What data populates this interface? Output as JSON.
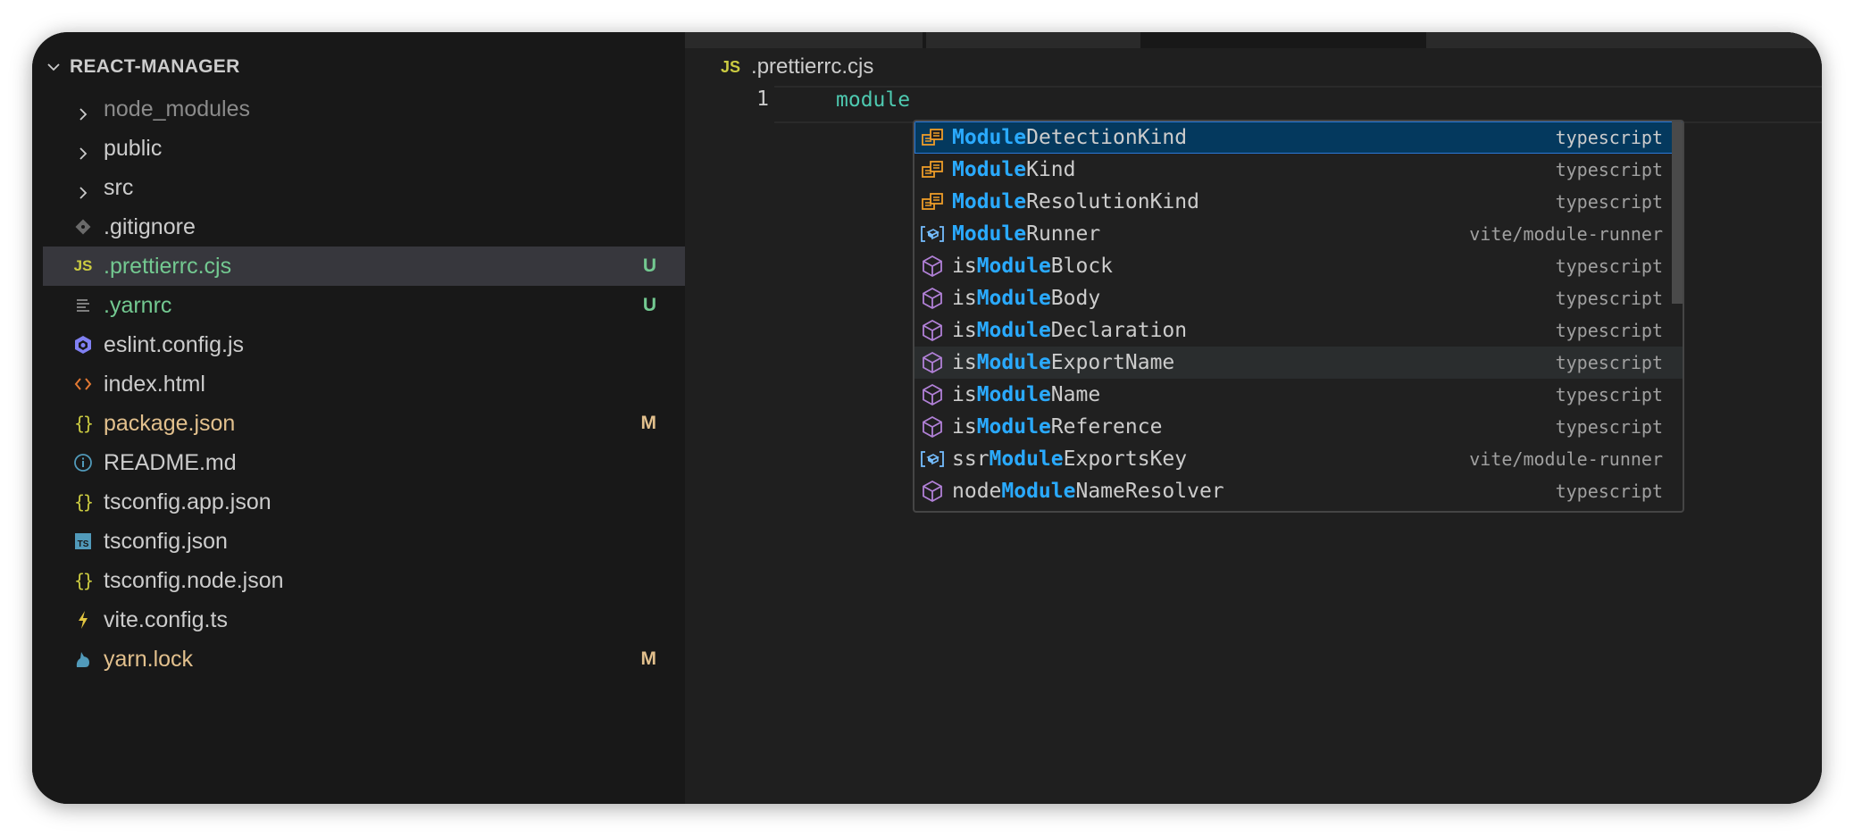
{
  "explorer": {
    "title": "REACT-MANAGER",
    "items": [
      {
        "label": "node_modules",
        "type": "folder",
        "icon": "chevron-right-icon",
        "color": "#8b8b8b",
        "badge": ""
      },
      {
        "label": "public",
        "type": "folder",
        "icon": "chevron-right-icon",
        "color": "#cccccc",
        "badge": ""
      },
      {
        "label": "src",
        "type": "folder",
        "icon": "chevron-right-icon",
        "color": "#cccccc",
        "badge": ""
      },
      {
        "label": ".gitignore",
        "type": "file",
        "icon": "git-icon",
        "color": "#cccccc",
        "badge": ""
      },
      {
        "label": ".prettierrc.cjs",
        "type": "file",
        "icon": "javascript-icon",
        "color": "#73c991",
        "badge": "U",
        "selected": true
      },
      {
        "label": ".yarnrc",
        "type": "file",
        "icon": "lines-icon",
        "color": "#73c991",
        "badge": "U"
      },
      {
        "label": "eslint.config.js",
        "type": "file",
        "icon": "eslint-icon",
        "color": "#cccccc",
        "badge": ""
      },
      {
        "label": "index.html",
        "type": "file",
        "icon": "html-icon",
        "color": "#cccccc",
        "badge": ""
      },
      {
        "label": "package.json",
        "type": "file",
        "icon": "json-braces-icon",
        "color": "#e2c08d",
        "badge": "M"
      },
      {
        "label": "README.md",
        "type": "file",
        "icon": "info-icon",
        "color": "#cccccc",
        "badge": ""
      },
      {
        "label": "tsconfig.app.json",
        "type": "file",
        "icon": "json-braces-icon",
        "color": "#cccccc",
        "badge": ""
      },
      {
        "label": "tsconfig.json",
        "type": "file",
        "icon": "typescript-icon",
        "color": "#cccccc",
        "badge": ""
      },
      {
        "label": "tsconfig.node.json",
        "type": "file",
        "icon": "json-braces-icon",
        "color": "#cccccc",
        "badge": ""
      },
      {
        "label": "vite.config.ts",
        "type": "file",
        "icon": "lightning-icon",
        "color": "#cccccc",
        "badge": ""
      },
      {
        "label": "yarn.lock",
        "type": "file",
        "icon": "yarn-cat-icon",
        "color": "#e2c08d",
        "badge": "M"
      }
    ]
  },
  "editor": {
    "breadcrumb_icon": "JS",
    "breadcrumb_file": ".prettierrc.cjs",
    "line_number": "1",
    "line_text": "module"
  },
  "suggest": {
    "items": [
      {
        "match": "Module",
        "prefix": "",
        "suffix": "DetectionKind",
        "detail": "typescript",
        "kind": "enum-icon",
        "active": true
      },
      {
        "match": "Module",
        "prefix": "",
        "suffix": "Kind",
        "detail": "typescript",
        "kind": "enum-icon"
      },
      {
        "match": "Module",
        "prefix": "",
        "suffix": "ResolutionKind",
        "detail": "typescript",
        "kind": "enum-icon"
      },
      {
        "match": "Module",
        "prefix": "",
        "suffix": "Runner",
        "detail": "vite/module-runner",
        "kind": "variable-icon"
      },
      {
        "match": "Module",
        "prefix": "is",
        "suffix": "Block",
        "detail": "typescript",
        "kind": "method-cube-icon"
      },
      {
        "match": "Module",
        "prefix": "is",
        "suffix": "Body",
        "detail": "typescript",
        "kind": "method-cube-icon"
      },
      {
        "match": "Module",
        "prefix": "is",
        "suffix": "Declaration",
        "detail": "typescript",
        "kind": "method-cube-icon"
      },
      {
        "match": "Module",
        "prefix": "is",
        "suffix": "ExportName",
        "detail": "typescript",
        "kind": "method-cube-icon",
        "hovered": true
      },
      {
        "match": "Module",
        "prefix": "is",
        "suffix": "Name",
        "detail": "typescript",
        "kind": "method-cube-icon"
      },
      {
        "match": "Module",
        "prefix": "is",
        "suffix": "Reference",
        "detail": "typescript",
        "kind": "method-cube-icon"
      },
      {
        "match": "Module",
        "prefix": "ssr",
        "suffix": "ExportsKey",
        "detail": "vite/module-runner",
        "kind": "variable-icon"
      },
      {
        "match": "Module",
        "prefix": "node",
        "suffix": "NameResolver",
        "detail": "typescript",
        "kind": "method-cube-icon"
      }
    ]
  }
}
